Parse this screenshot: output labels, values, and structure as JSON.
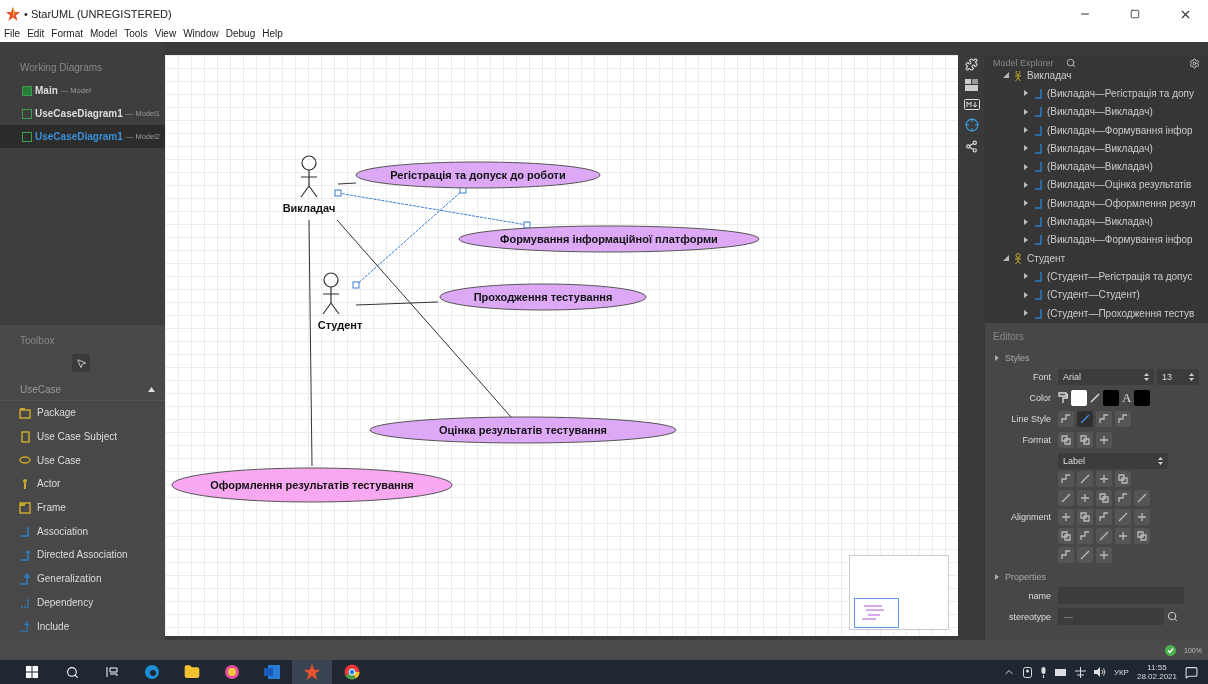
{
  "window": {
    "title": "• StarUML (UNREGISTERED)"
  },
  "menu": [
    "File",
    "Edit",
    "Format",
    "Model",
    "Tools",
    "View",
    "Window",
    "Debug",
    "Help"
  ],
  "working_diagrams": {
    "title": "Working Diagrams",
    "items": [
      {
        "name": "Main",
        "model": "— Model",
        "selected": false
      },
      {
        "name": "UseCaseDiagram1",
        "model": "— Model1",
        "selected": false
      },
      {
        "name": "UseCaseDiagram1",
        "model": "— Model2",
        "selected": true
      }
    ]
  },
  "toolbox": {
    "title": "Toolbox",
    "section": "UseCase",
    "expanded": true,
    "items": [
      {
        "label": "Package",
        "kind": "package"
      },
      {
        "label": "Use Case Subject",
        "kind": "subject"
      },
      {
        "label": "Use Case",
        "kind": "usecase"
      },
      {
        "label": "Actor",
        "kind": "actor"
      },
      {
        "label": "Frame",
        "kind": "frame"
      },
      {
        "label": "Association",
        "kind": "association"
      },
      {
        "label": "Directed Association",
        "kind": "directed"
      },
      {
        "label": "Generalization",
        "kind": "generalization"
      },
      {
        "label": "Dependency",
        "kind": "dependency"
      },
      {
        "label": "Include",
        "kind": "include"
      }
    ]
  },
  "diagram": {
    "actors": [
      {
        "name": "Викладач"
      },
      {
        "name": "Студент"
      }
    ],
    "use_cases": [
      {
        "label": "Регістрація та допуск до роботи",
        "color": "#dda9f6"
      },
      {
        "label": "Формування інформаційної платформи",
        "color": "#dda9f6"
      },
      {
        "label": "Проходження тестування",
        "color": "#dda9f6"
      },
      {
        "label": "Оцінка результатів тестування",
        "color": "#dda9f6"
      },
      {
        "label": "Оформлення результатів тестування",
        "color": "#f7a8f1"
      }
    ],
    "connections": [
      {
        "selected": false
      },
      {
        "selected": true
      },
      {
        "selected": true
      },
      {
        "selected": false
      },
      {
        "selected": false
      },
      {
        "selected": false
      }
    ]
  },
  "model_explorer": {
    "title": "Model Explorer",
    "tree": [
      {
        "label": "Викладач",
        "expanded": true,
        "children": [
          {
            "label": "(Викладач—Регістрація та допу",
            "expanded": false
          },
          {
            "label": "(Викладач—Викладач)",
            "expanded": false
          },
          {
            "label": "(Викладач—Формування інфор",
            "expanded": false
          },
          {
            "label": "(Викладач—Викладач)",
            "expanded": false
          },
          {
            "label": "(Викладач—Викладач)",
            "expanded": false
          },
          {
            "label": "(Викладач—Оцінка результатів",
            "expanded": false
          },
          {
            "label": "(Викладач—Оформлення резул",
            "expanded": false
          },
          {
            "label": "(Викладач—Викладач)",
            "expanded": false
          },
          {
            "label": "(Викладач—Формування інфор",
            "expanded": false
          }
        ]
      },
      {
        "label": "Студент",
        "expanded": true,
        "children": [
          {
            "label": "(Студент—Регістрація та допус",
            "expanded": false
          },
          {
            "label": "(Студент—Студент)",
            "expanded": false
          },
          {
            "label": "(Студент—Проходження тестув",
            "expanded": false
          }
        ]
      }
    ]
  },
  "editors": {
    "title": "Editors",
    "styles": {
      "title": "Styles",
      "font_label": "Font",
      "font": "Arial",
      "size": "13",
      "color_label": "Color",
      "swatches": [
        {
          "kind": "fill",
          "color": "#ffffff"
        },
        {
          "kind": "line",
          "color": "#000000"
        },
        {
          "kind": "font",
          "glyph": "A",
          "color": "#000000"
        }
      ],
      "line_style_label": "Line Style",
      "line_styles": [
        {
          "selected": false
        },
        {
          "selected": true
        },
        {
          "selected": false
        },
        {
          "selected": false
        }
      ],
      "format_label": "Format",
      "label_select": "Label",
      "alignment_label": "Alignment"
    },
    "properties": {
      "title": "Properties",
      "fields": [
        {
          "label": "name"
        },
        {
          "label": "stereotype",
          "value": "—"
        }
      ]
    }
  },
  "status_bar": {
    "zoom": "100%"
  },
  "taskbar": {
    "language": "УКР",
    "time": "11:55",
    "date": "28.02.2021"
  }
}
